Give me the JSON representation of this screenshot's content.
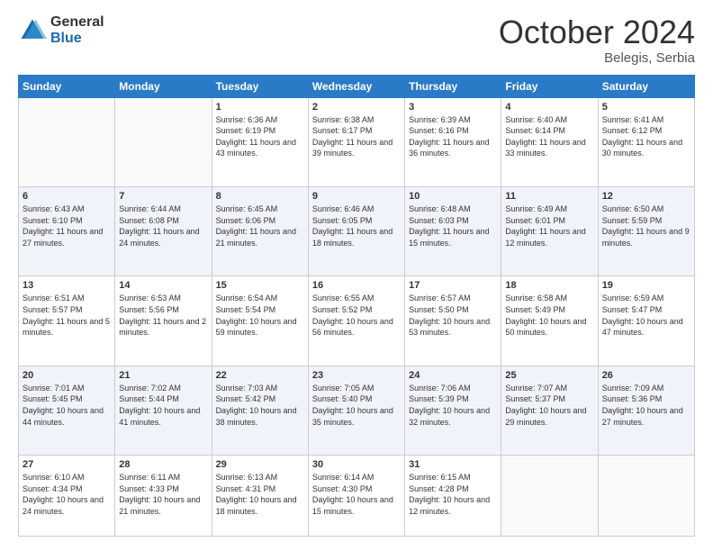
{
  "logo": {
    "general": "General",
    "blue": "Blue"
  },
  "header": {
    "month": "October 2024",
    "location": "Belegis, Serbia"
  },
  "weekdays": [
    "Sunday",
    "Monday",
    "Tuesday",
    "Wednesday",
    "Thursday",
    "Friday",
    "Saturday"
  ],
  "weeks": [
    [
      {
        "day": "",
        "sunrise": "",
        "sunset": "",
        "daylight": ""
      },
      {
        "day": "",
        "sunrise": "",
        "sunset": "",
        "daylight": ""
      },
      {
        "day": "1",
        "sunrise": "Sunrise: 6:36 AM",
        "sunset": "Sunset: 6:19 PM",
        "daylight": "Daylight: 11 hours and 43 minutes."
      },
      {
        "day": "2",
        "sunrise": "Sunrise: 6:38 AM",
        "sunset": "Sunset: 6:17 PM",
        "daylight": "Daylight: 11 hours and 39 minutes."
      },
      {
        "day": "3",
        "sunrise": "Sunrise: 6:39 AM",
        "sunset": "Sunset: 6:16 PM",
        "daylight": "Daylight: 11 hours and 36 minutes."
      },
      {
        "day": "4",
        "sunrise": "Sunrise: 6:40 AM",
        "sunset": "Sunset: 6:14 PM",
        "daylight": "Daylight: 11 hours and 33 minutes."
      },
      {
        "day": "5",
        "sunrise": "Sunrise: 6:41 AM",
        "sunset": "Sunset: 6:12 PM",
        "daylight": "Daylight: 11 hours and 30 minutes."
      }
    ],
    [
      {
        "day": "6",
        "sunrise": "Sunrise: 6:43 AM",
        "sunset": "Sunset: 6:10 PM",
        "daylight": "Daylight: 11 hours and 27 minutes."
      },
      {
        "day": "7",
        "sunrise": "Sunrise: 6:44 AM",
        "sunset": "Sunset: 6:08 PM",
        "daylight": "Daylight: 11 hours and 24 minutes."
      },
      {
        "day": "8",
        "sunrise": "Sunrise: 6:45 AM",
        "sunset": "Sunset: 6:06 PM",
        "daylight": "Daylight: 11 hours and 21 minutes."
      },
      {
        "day": "9",
        "sunrise": "Sunrise: 6:46 AM",
        "sunset": "Sunset: 6:05 PM",
        "daylight": "Daylight: 11 hours and 18 minutes."
      },
      {
        "day": "10",
        "sunrise": "Sunrise: 6:48 AM",
        "sunset": "Sunset: 6:03 PM",
        "daylight": "Daylight: 11 hours and 15 minutes."
      },
      {
        "day": "11",
        "sunrise": "Sunrise: 6:49 AM",
        "sunset": "Sunset: 6:01 PM",
        "daylight": "Daylight: 11 hours and 12 minutes."
      },
      {
        "day": "12",
        "sunrise": "Sunrise: 6:50 AM",
        "sunset": "Sunset: 5:59 PM",
        "daylight": "Daylight: 11 hours and 9 minutes."
      }
    ],
    [
      {
        "day": "13",
        "sunrise": "Sunrise: 6:51 AM",
        "sunset": "Sunset: 5:57 PM",
        "daylight": "Daylight: 11 hours and 5 minutes."
      },
      {
        "day": "14",
        "sunrise": "Sunrise: 6:53 AM",
        "sunset": "Sunset: 5:56 PM",
        "daylight": "Daylight: 11 hours and 2 minutes."
      },
      {
        "day": "15",
        "sunrise": "Sunrise: 6:54 AM",
        "sunset": "Sunset: 5:54 PM",
        "daylight": "Daylight: 10 hours and 59 minutes."
      },
      {
        "day": "16",
        "sunrise": "Sunrise: 6:55 AM",
        "sunset": "Sunset: 5:52 PM",
        "daylight": "Daylight: 10 hours and 56 minutes."
      },
      {
        "day": "17",
        "sunrise": "Sunrise: 6:57 AM",
        "sunset": "Sunset: 5:50 PM",
        "daylight": "Daylight: 10 hours and 53 minutes."
      },
      {
        "day": "18",
        "sunrise": "Sunrise: 6:58 AM",
        "sunset": "Sunset: 5:49 PM",
        "daylight": "Daylight: 10 hours and 50 minutes."
      },
      {
        "day": "19",
        "sunrise": "Sunrise: 6:59 AM",
        "sunset": "Sunset: 5:47 PM",
        "daylight": "Daylight: 10 hours and 47 minutes."
      }
    ],
    [
      {
        "day": "20",
        "sunrise": "Sunrise: 7:01 AM",
        "sunset": "Sunset: 5:45 PM",
        "daylight": "Daylight: 10 hours and 44 minutes."
      },
      {
        "day": "21",
        "sunrise": "Sunrise: 7:02 AM",
        "sunset": "Sunset: 5:44 PM",
        "daylight": "Daylight: 10 hours and 41 minutes."
      },
      {
        "day": "22",
        "sunrise": "Sunrise: 7:03 AM",
        "sunset": "Sunset: 5:42 PM",
        "daylight": "Daylight: 10 hours and 38 minutes."
      },
      {
        "day": "23",
        "sunrise": "Sunrise: 7:05 AM",
        "sunset": "Sunset: 5:40 PM",
        "daylight": "Daylight: 10 hours and 35 minutes."
      },
      {
        "day": "24",
        "sunrise": "Sunrise: 7:06 AM",
        "sunset": "Sunset: 5:39 PM",
        "daylight": "Daylight: 10 hours and 32 minutes."
      },
      {
        "day": "25",
        "sunrise": "Sunrise: 7:07 AM",
        "sunset": "Sunset: 5:37 PM",
        "daylight": "Daylight: 10 hours and 29 minutes."
      },
      {
        "day": "26",
        "sunrise": "Sunrise: 7:09 AM",
        "sunset": "Sunset: 5:36 PM",
        "daylight": "Daylight: 10 hours and 27 minutes."
      }
    ],
    [
      {
        "day": "27",
        "sunrise": "Sunrise: 6:10 AM",
        "sunset": "Sunset: 4:34 PM",
        "daylight": "Daylight: 10 hours and 24 minutes."
      },
      {
        "day": "28",
        "sunrise": "Sunrise: 6:11 AM",
        "sunset": "Sunset: 4:33 PM",
        "daylight": "Daylight: 10 hours and 21 minutes."
      },
      {
        "day": "29",
        "sunrise": "Sunrise: 6:13 AM",
        "sunset": "Sunset: 4:31 PM",
        "daylight": "Daylight: 10 hours and 18 minutes."
      },
      {
        "day": "30",
        "sunrise": "Sunrise: 6:14 AM",
        "sunset": "Sunset: 4:30 PM",
        "daylight": "Daylight: 10 hours and 15 minutes."
      },
      {
        "day": "31",
        "sunrise": "Sunrise: 6:15 AM",
        "sunset": "Sunset: 4:28 PM",
        "daylight": "Daylight: 10 hours and 12 minutes."
      },
      {
        "day": "",
        "sunrise": "",
        "sunset": "",
        "daylight": ""
      },
      {
        "day": "",
        "sunrise": "",
        "sunset": "",
        "daylight": ""
      }
    ]
  ]
}
